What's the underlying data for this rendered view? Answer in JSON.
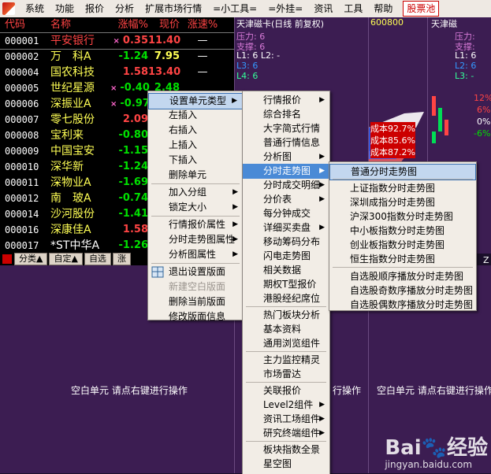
{
  "menubar": {
    "items": [
      "系统",
      "功能",
      "报价",
      "分析",
      "扩展市场行情",
      "=小工具=",
      "=外挂=",
      "资讯",
      "工具",
      "帮助"
    ],
    "accent_item": "股票池"
  },
  "quote": {
    "headers": [
      "代码",
      "名称",
      "涨幅%",
      "现价",
      "涨速%"
    ],
    "rows": [
      {
        "code": "000001",
        "name": "平安银行",
        "mark": "×",
        "chg": "0.35",
        "price": "11.40",
        "speed": "—",
        "chg_color": "#ff4444",
        "price_color": "#ff4444",
        "name_color": "#ff4444"
      },
      {
        "code": "000002",
        "name": "万　科A",
        "mark": "",
        "chg": "-1.24",
        "price": "7.95",
        "speed": "—",
        "chg_color": "#00e000",
        "price_color": "#ffff55",
        "name_color": "#ffff55"
      },
      {
        "code": "000004",
        "name": "国农科技",
        "mark": "",
        "chg": "1.58",
        "price": "13.40",
        "speed": "—",
        "chg_color": "#ff4444",
        "price_color": "#ff4444",
        "name_color": "#ffff55"
      },
      {
        "code": "000005",
        "name": "世纪星源",
        "mark": "×",
        "chg": "-0.40",
        "price": "2.48",
        "speed": "",
        "chg_color": "#00e000",
        "price_color": "#00e000",
        "name_color": "#ffff55"
      },
      {
        "code": "000006",
        "name": "深振业A",
        "mark": "×",
        "chg": "-0.97",
        "price": "",
        "speed": "",
        "chg_color": "#00e000",
        "price_color": "#00e000",
        "name_color": "#ffff55"
      },
      {
        "code": "000007",
        "name": "零七股份",
        "mark": "",
        "chg": "2.09",
        "price": "",
        "speed": "",
        "chg_color": "#ff4444",
        "price_color": "#ff4444",
        "name_color": "#ffff55"
      },
      {
        "code": "000008",
        "name": "宝利来",
        "mark": "",
        "chg": "-0.80",
        "price": "",
        "speed": "",
        "chg_color": "#00e000",
        "price_color": "#00e000",
        "name_color": "#ffff55"
      },
      {
        "code": "000009",
        "name": "中国宝安",
        "mark": "",
        "chg": "-1.15",
        "price": "",
        "speed": "",
        "chg_color": "#00e000",
        "price_color": "#00e000",
        "name_color": "#ffff55"
      },
      {
        "code": "000010",
        "name": "深华新",
        "mark": "",
        "chg": "-1.24",
        "price": "",
        "speed": "",
        "chg_color": "#00e000",
        "price_color": "#00e000",
        "name_color": "#ffff55"
      },
      {
        "code": "000011",
        "name": "深物业A",
        "mark": "",
        "chg": "-1.69",
        "price": "",
        "speed": "",
        "chg_color": "#00e000",
        "price_color": "#00e000",
        "name_color": "#ffff55"
      },
      {
        "code": "000012",
        "name": "南　玻A",
        "mark": "",
        "chg": "-0.74",
        "price": "",
        "speed": "",
        "chg_color": "#00e000",
        "price_color": "#00e000",
        "name_color": "#ffff55"
      },
      {
        "code": "000014",
        "name": "沙河股份",
        "mark": "",
        "chg": "-1.41",
        "price": "",
        "speed": "",
        "chg_color": "#00e000",
        "price_color": "#00e000",
        "name_color": "#ffff55"
      },
      {
        "code": "000016",
        "name": "深康佳A",
        "mark": "",
        "chg": "1.58",
        "price": "",
        "speed": "",
        "chg_color": "#ff4444",
        "price_color": "#ff4444",
        "name_color": "#ffff55"
      },
      {
        "code": "000017",
        "name": "*ST中华A",
        "mark": "",
        "chg": "-1.26",
        "price": "",
        "speed": "",
        "chg_color": "#00e000",
        "price_color": "#00e000",
        "name_color": "#ffffff"
      }
    ],
    "tabs": [
      "分类▲",
      "自定▲",
      "自选",
      "涨"
    ]
  },
  "panels": {
    "p1_title": "天津磁卡(日线 前复权)",
    "p1_lines": [
      "压力: 6",
      "支撑: 6",
      "L1: 6  L2: -",
      "L3: 6",
      "L4: 6"
    ],
    "p2_title": "600800",
    "p3_title": "天津磁",
    "p3_lines": [
      "压力:",
      "支撑:",
      "L1: 6",
      "L2: 6",
      "L3: -"
    ],
    "pct_labels": [
      "12%",
      "6%",
      "0%",
      "-6%"
    ],
    "cost_labels": [
      "成本92.7%",
      "成本85.6%",
      "成本87.2%"
    ],
    "blank_text": "空白单元 请点右键进行操作",
    "blank_text_short": "行操作",
    "extra_z": "Z"
  },
  "menu1": {
    "items": [
      "设置单元类型",
      "左插入",
      "右插入",
      "上插入",
      "下插入",
      "删除单元",
      "加入分组",
      "锁定大小",
      "行情报价属性",
      "分时走势图属性",
      "分析图属性",
      "退出设置版面",
      "新建空白版面",
      "删除当前版面",
      "修改版面信息"
    ]
  },
  "menu2": {
    "items": [
      "行情报价",
      "综合排名",
      "大字简式行情",
      "普通行情信息",
      "分析图",
      "分时走势图",
      "分时成交明细",
      "分价表",
      "每分钟成交",
      "详细买卖盘",
      "移动筹码分布",
      "闪电走势图",
      "相关数据",
      "期权T型报价",
      "港股经纪席位",
      "热门板块分析",
      "基本资料",
      "通用浏览组件",
      "主力监控精灵",
      "市场雷达",
      "关联报价",
      "Level2组件",
      "资讯工场组件",
      "研究终端组件",
      "板块指数全景",
      "星空图"
    ]
  },
  "menu3": {
    "items": [
      "普通分时走势图",
      "上证指数分时走势图",
      "深圳成指分时走势图",
      "沪深300指数分时走势图",
      "中小板指数分时走势图",
      "创业板指数分时走势图",
      "恒生指数分时走势图",
      "自选股顺序播放分时走势图",
      "自选股奇数序播放分时走势图",
      "自选股偶数序播放分时走势图"
    ]
  },
  "watermark": {
    "brand": "Bai",
    "brand2": "经验",
    "url": "jingyan.baidu.com"
  }
}
